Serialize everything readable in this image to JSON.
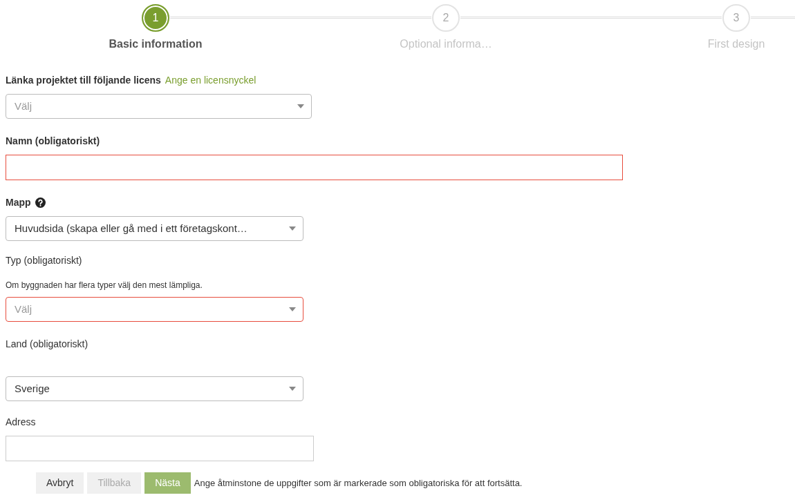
{
  "steps": [
    {
      "number": "1",
      "label": "Basic information",
      "selected": true
    },
    {
      "number": "2",
      "label": "Optional informa…",
      "selected": false
    },
    {
      "number": "3",
      "label": "First design",
      "selected": false
    }
  ],
  "fields": [
    {
      "kind": "select",
      "label": "Länka projektet till följande licens",
      "bold": true,
      "link": "Ange en licensnyckel",
      "placeholder": "Välj",
      "invalid": false
    },
    {
      "kind": "text",
      "label": "Namn (obligatoriskt)",
      "bold": true,
      "invalid": true
    },
    {
      "kind": "select",
      "label": "Mapp",
      "bold": true,
      "help": true,
      "value": "Huvudsida (skapa eller gå med i ett företagskont…",
      "invalid": false
    },
    {
      "kind": "select",
      "label": "Typ (obligatoriskt)",
      "bold": false,
      "hint": "Om byggnaden har flera typer välj den mest lämpliga.",
      "placeholder": "Välj",
      "invalid": true
    },
    {
      "kind": "select",
      "label": "Land (obligatoriskt)",
      "bold": false,
      "value": "Sverige",
      "invalid": false
    },
    {
      "kind": "text",
      "label": "Adress",
      "bold": false,
      "invalid": false
    }
  ],
  "buttons": [
    {
      "label": "Avbryt",
      "kind": "default",
      "disabled": false
    },
    {
      "label": "Tillbaka",
      "kind": "default",
      "disabled": true
    },
    {
      "label": "Nästa",
      "kind": "primary",
      "disabled": false
    }
  ],
  "message": "Ange åtminstone de uppgifter som är markerade som obligatoriska för att fortsätta."
}
